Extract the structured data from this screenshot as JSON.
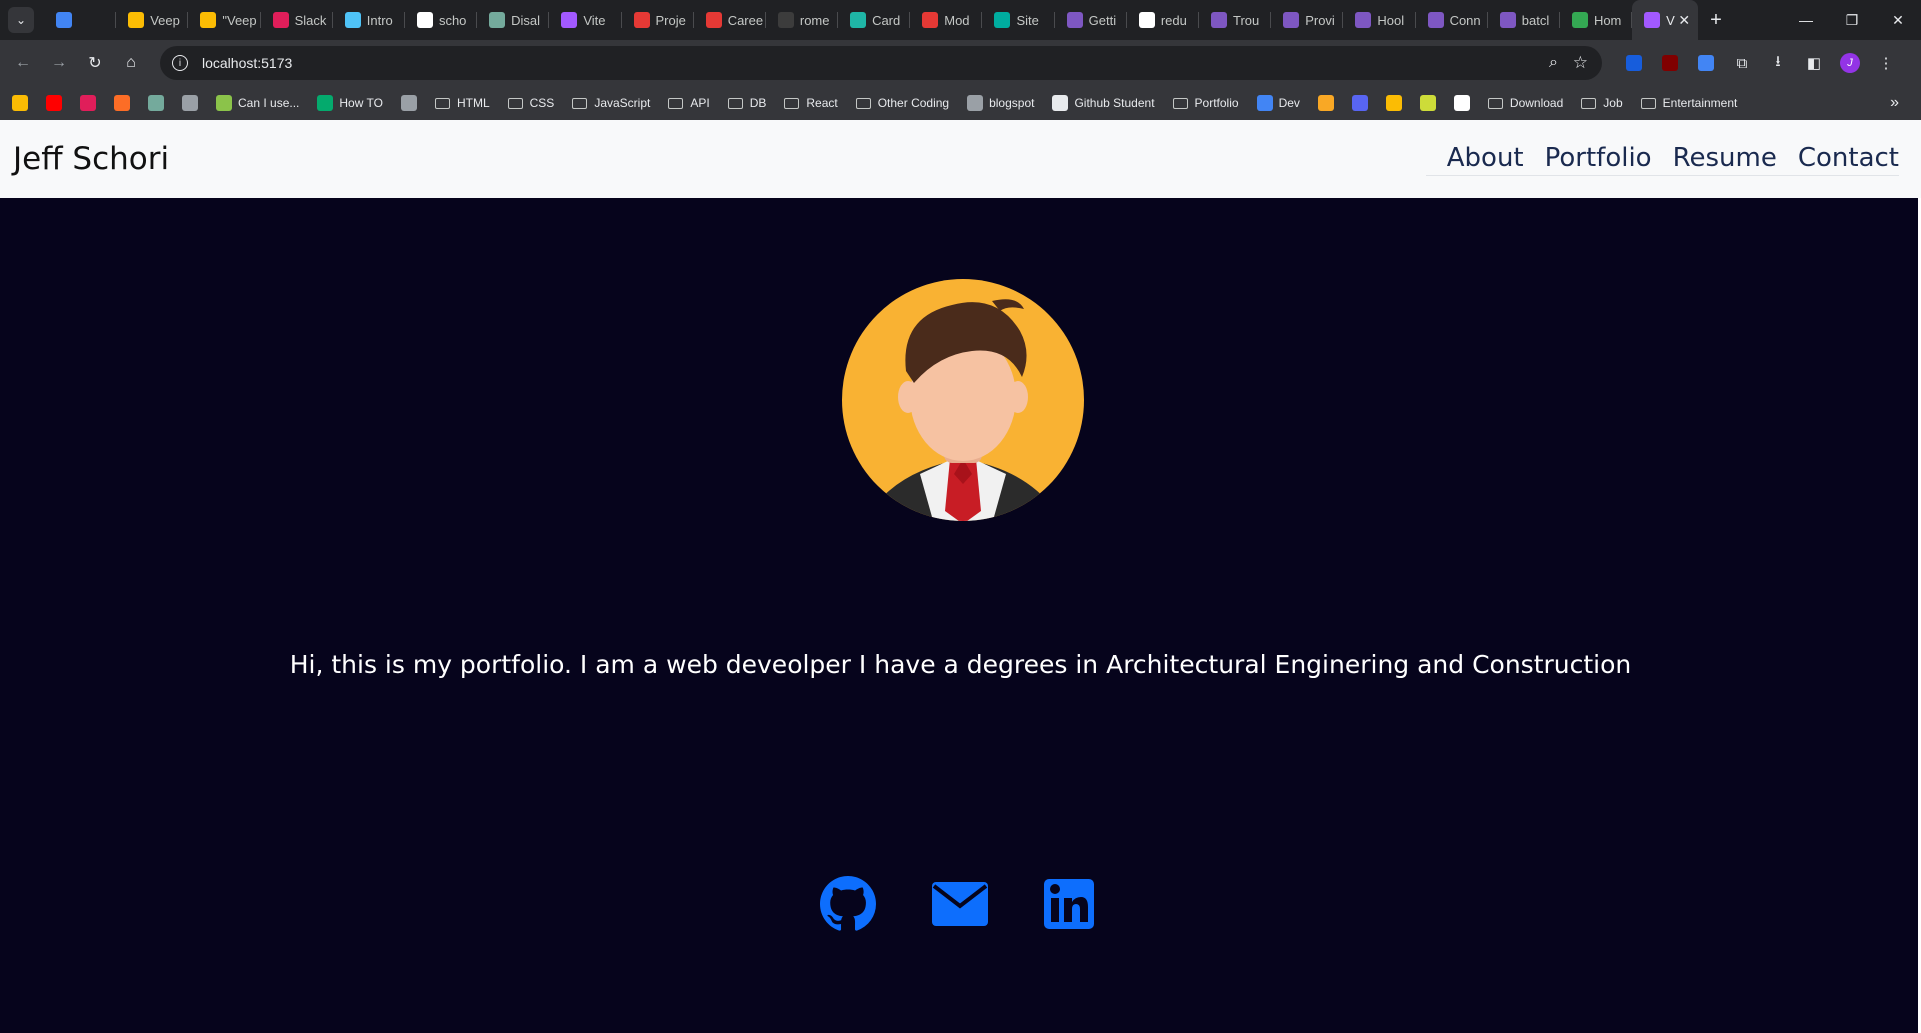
{
  "browser": {
    "tabs": [
      {
        "label": "",
        "color": "#4285f4"
      },
      {
        "label": "Veep",
        "color": "#fbbc04"
      },
      {
        "label": "\"Veep",
        "color": "#fbbc04"
      },
      {
        "label": "Slack",
        "color": "#e01e5a"
      },
      {
        "label": "Intro",
        "color": "#4fc3f7"
      },
      {
        "label": "scho",
        "color": "#ffffff"
      },
      {
        "label": "Disal",
        "color": "#74aa9c"
      },
      {
        "label": "Vite",
        "color": "#a259ff"
      },
      {
        "label": "Proje",
        "color": "#e53935"
      },
      {
        "label": "Caree",
        "color": "#e53935"
      },
      {
        "label": "rome",
        "color": "#3c3c3c"
      },
      {
        "label": "Card",
        "color": "#1fb6a6"
      },
      {
        "label": "Mod",
        "color": "#e53935"
      },
      {
        "label": "Site",
        "color": "#00ad9f"
      },
      {
        "label": "Getti",
        "color": "#7e57c2"
      },
      {
        "label": "redu",
        "color": "#ffffff"
      },
      {
        "label": "Trou",
        "color": "#7e57c2"
      },
      {
        "label": "Provi",
        "color": "#7e57c2"
      },
      {
        "label": "Hool",
        "color": "#7e57c2"
      },
      {
        "label": "Conn",
        "color": "#7e57c2"
      },
      {
        "label": "batcl",
        "color": "#7e57c2"
      },
      {
        "label": "Hom",
        "color": "#34a853"
      }
    ],
    "active_tab": {
      "label": "V",
      "color": "#a259ff"
    },
    "url": "localhost:5173",
    "bookmarks": [
      {
        "label": "",
        "type": "icon",
        "color": "#fbbc04"
      },
      {
        "label": "",
        "type": "icon",
        "color": "#ff0000"
      },
      {
        "label": "",
        "type": "icon",
        "color": "#e01e5a"
      },
      {
        "label": "",
        "type": "icon",
        "color": "#fc6d26"
      },
      {
        "label": "",
        "type": "icon",
        "color": "#74aa9c"
      },
      {
        "label": "",
        "type": "icon",
        "color": "#9aa0a6"
      },
      {
        "label": "Can I use...",
        "type": "icon",
        "color": "#8bc34a"
      },
      {
        "label": "How TO",
        "type": "icon",
        "color": "#04aa6d"
      },
      {
        "label": "",
        "type": "icon",
        "color": "#9aa0a6"
      },
      {
        "label": "HTML",
        "type": "folder"
      },
      {
        "label": "CSS",
        "type": "folder"
      },
      {
        "label": "JavaScript",
        "type": "folder"
      },
      {
        "label": "API",
        "type": "folder"
      },
      {
        "label": "DB",
        "type": "folder"
      },
      {
        "label": "React",
        "type": "folder"
      },
      {
        "label": "Other Coding",
        "type": "folder"
      },
      {
        "label": "blogspot",
        "type": "icon",
        "color": "#9aa0a6"
      },
      {
        "label": "Github Student",
        "type": "icon",
        "color": "#e8eaed"
      },
      {
        "label": "Portfolio",
        "type": "folder"
      },
      {
        "label": "Dev",
        "type": "icon",
        "color": "#4285f4"
      },
      {
        "label": "",
        "type": "icon",
        "color": "#f9a825"
      },
      {
        "label": "",
        "type": "icon",
        "color": "#5865f2"
      },
      {
        "label": "",
        "type": "icon",
        "color": "#fbbc04"
      },
      {
        "label": "",
        "type": "icon",
        "color": "#cddc39"
      },
      {
        "label": "",
        "type": "icon",
        "color": "#ffffff"
      },
      {
        "label": "Download",
        "type": "folder"
      },
      {
        "label": "Job",
        "type": "folder"
      },
      {
        "label": "Entertainment",
        "type": "folder"
      }
    ]
  },
  "site": {
    "brand": "Jeff Schori",
    "nav": [
      "About",
      "Portfolio",
      "Resume",
      "Contact"
    ],
    "intro": "Hi, this is my portfolio. I am a web deveolper I have a degrees in Architectural Enginering and Construction",
    "socials": [
      "github-icon",
      "email-icon",
      "linkedin-icon"
    ],
    "colors": {
      "background": "#06041c",
      "header_bg": "#f8f9fa",
      "nav_text": "#1a2a4f",
      "social_icon": "#0d6efd",
      "avatar_bg": "#f9b233"
    }
  }
}
